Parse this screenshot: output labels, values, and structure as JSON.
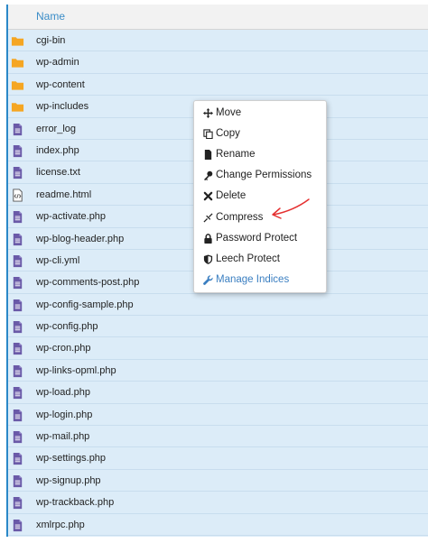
{
  "header": {
    "name_label": "Name"
  },
  "files": [
    {
      "name": "cgi-bin",
      "type": "folder"
    },
    {
      "name": "wp-admin",
      "type": "folder"
    },
    {
      "name": "wp-content",
      "type": "folder"
    },
    {
      "name": "wp-includes",
      "type": "folder"
    },
    {
      "name": "error_log",
      "type": "file"
    },
    {
      "name": "index.php",
      "type": "file"
    },
    {
      "name": "license.txt",
      "type": "file"
    },
    {
      "name": "readme.html",
      "type": "html"
    },
    {
      "name": "wp-activate.php",
      "type": "file"
    },
    {
      "name": "wp-blog-header.php",
      "type": "file"
    },
    {
      "name": "wp-cli.yml",
      "type": "file"
    },
    {
      "name": "wp-comments-post.php",
      "type": "file"
    },
    {
      "name": "wp-config-sample.php",
      "type": "file"
    },
    {
      "name": "wp-config.php",
      "type": "file"
    },
    {
      "name": "wp-cron.php",
      "type": "file"
    },
    {
      "name": "wp-links-opml.php",
      "type": "file"
    },
    {
      "name": "wp-load.php",
      "type": "file"
    },
    {
      "name": "wp-login.php",
      "type": "file"
    },
    {
      "name": "wp-mail.php",
      "type": "file"
    },
    {
      "name": "wp-settings.php",
      "type": "file"
    },
    {
      "name": "wp-signup.php",
      "type": "file"
    },
    {
      "name": "wp-trackback.php",
      "type": "file"
    },
    {
      "name": "xmlrpc.php",
      "type": "file"
    }
  ],
  "context_menu": {
    "items": [
      {
        "label": "Move",
        "icon": "move-icon"
      },
      {
        "label": "Copy",
        "icon": "copy-icon"
      },
      {
        "label": "Rename",
        "icon": "file-icon"
      },
      {
        "label": "Change Permissions",
        "icon": "key-icon"
      },
      {
        "label": "Delete",
        "icon": "close-icon"
      },
      {
        "label": "Compress",
        "icon": "compress-icon"
      },
      {
        "label": "Password Protect",
        "icon": "lock-icon"
      },
      {
        "label": "Leech Protect",
        "icon": "shield-icon"
      },
      {
        "label": "Manage Indices",
        "icon": "wrench-icon"
      }
    ]
  },
  "colors": {
    "folder": "#f5a623",
    "file": "#6a5aa8",
    "accent": "#2a88c8",
    "arrow": "#e53030"
  }
}
